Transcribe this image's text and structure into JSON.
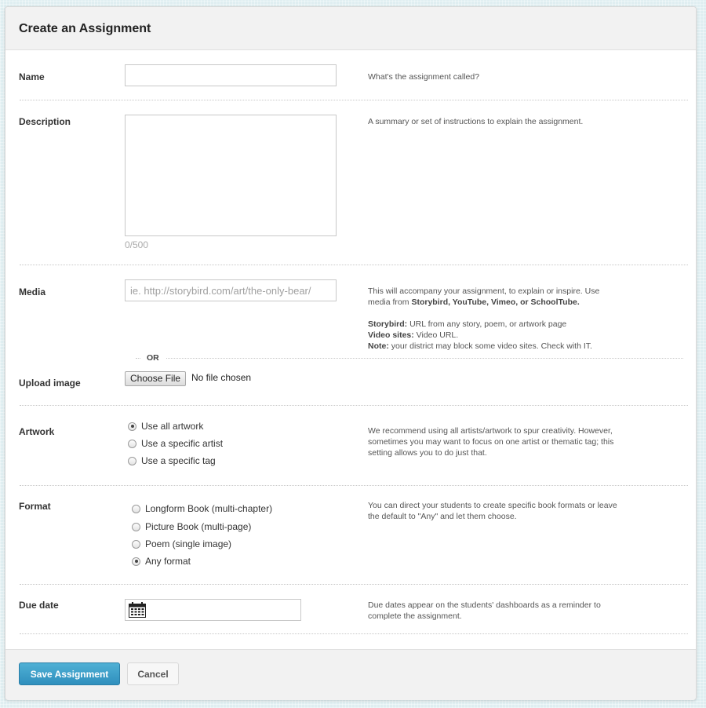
{
  "title": "Create an Assignment",
  "name_row": {
    "label": "Name",
    "value": "",
    "help": "What's the assignment called?"
  },
  "description_row": {
    "label": "Description",
    "value": "",
    "counter": "0/500",
    "help": "A summary or set of instructions to explain the assignment."
  },
  "media_row": {
    "label": "Media",
    "placeholder": "ie. http://storybird.com/art/the-only-bear/",
    "help_line1": "This will accompany your assignment, to explain or inspire. Use media from ",
    "help_line1_bold": "Storybird, YouTube, Vimeo, or SchoolTube.",
    "storybird_label": "Storybird:",
    "storybird_text": " URL from any story, poem, or artwork page",
    "video_label": "Video sites:",
    "video_text": " Video URL.",
    "note_label": "Note:",
    "note_text": " your district may block some video sites. Check with IT."
  },
  "or_text": "OR",
  "upload_row": {
    "label": "Upload image",
    "button": "Choose File",
    "status": "No file chosen"
  },
  "artwork_row": {
    "label": "Artwork",
    "options": [
      "Use all artwork",
      "Use a specific artist",
      "Use a specific tag"
    ],
    "selected": "Use all artwork",
    "help": "We recommend using all artists/artwork to spur creativity. However, sometimes you may want to focus on one artist or thematic tag; this setting allows you to do just that."
  },
  "format_row": {
    "label": "Format",
    "options": [
      "Longform Book (multi-chapter)",
      "Picture Book (multi-page)",
      "Poem (single image)",
      "Any format"
    ],
    "selected": "Any format",
    "help": "You can direct your students to create specific book formats or leave the default to \"Any\" and let them choose."
  },
  "due_date_row": {
    "label": "Due date",
    "value": "",
    "help": "Due dates appear on the students' dashboards as a reminder to complete the assignment."
  },
  "footer": {
    "save_label": "Save Assignment",
    "cancel_label": "Cancel"
  },
  "colors": {
    "primary": "#3a9ec8",
    "background": "#dfeef1"
  },
  "icons": {
    "date": "calendar-icon"
  }
}
